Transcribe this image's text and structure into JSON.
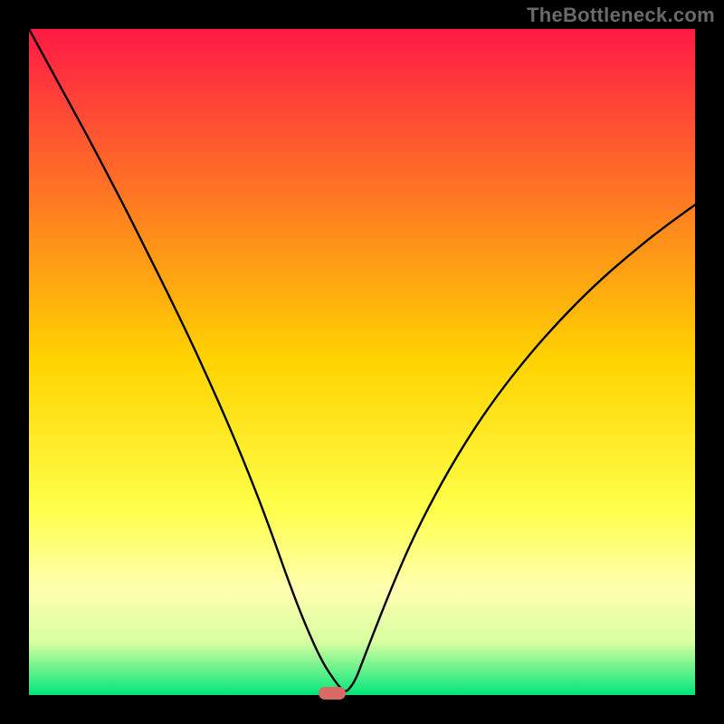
{
  "watermark": "TheBottleneck.com",
  "marker": {
    "left_pct": 45.5,
    "bottom_pct": 0.2
  },
  "gradient": {
    "stops": [
      {
        "offset": 0,
        "color": "#ff1a46"
      },
      {
        "offset": 50,
        "color": "#ffd400"
      },
      {
        "offset": 72,
        "color": "#ffff4a"
      },
      {
        "offset": 84,
        "color": "#ffffb0"
      },
      {
        "offset": 92,
        "color": "#d8ffa0"
      },
      {
        "offset": 100,
        "color": "#00e67a"
      }
    ]
  },
  "chart_data": {
    "type": "line",
    "title": "",
    "xlabel": "",
    "ylabel": "",
    "xlim": [
      0,
      100
    ],
    "ylim": [
      0,
      100
    ],
    "x": [
      0,
      3,
      6,
      9,
      12,
      15,
      18,
      21,
      24,
      27,
      30,
      33,
      36,
      39,
      41.5,
      44,
      46,
      47,
      47.5,
      48,
      49,
      50,
      52,
      55,
      58,
      62,
      66,
      70,
      75,
      80,
      85,
      90,
      95,
      100
    ],
    "values": [
      100,
      94.5,
      89,
      83.5,
      77.8,
      72,
      66,
      60,
      53.8,
      47.3,
      40.5,
      33.3,
      25.5,
      17,
      10.5,
      5,
      2,
      0.8,
      0.5,
      0.8,
      2.2,
      4.8,
      10,
      17.5,
      24.3,
      32,
      38.7,
      44.6,
      51,
      56.6,
      61.6,
      66,
      70,
      73.6
    ],
    "annotations": []
  }
}
